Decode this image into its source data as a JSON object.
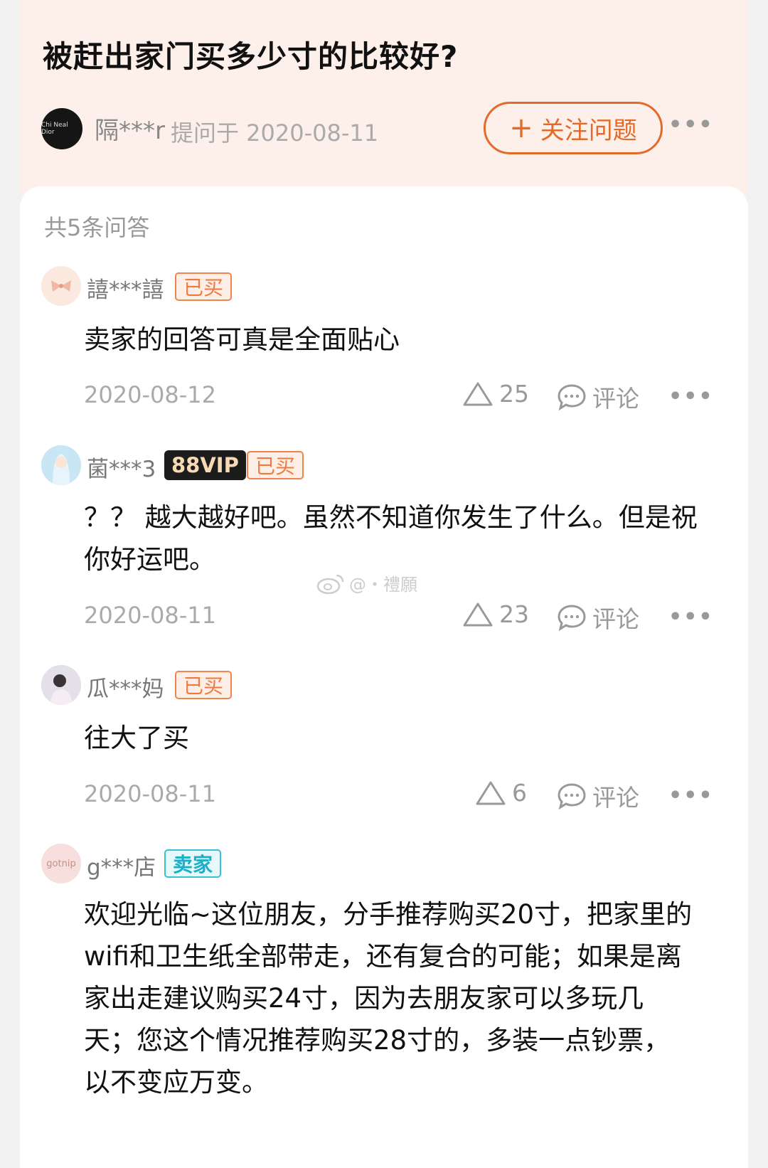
{
  "question": {
    "title": "被赶出家门买多少寸的比较好?",
    "asker_name": "隔***r",
    "asker_meta": "提问于 2020-08-11",
    "asker_avatar_text": "Chi Neal Dior",
    "follow_label": "关注问题",
    "follow_icon": "+"
  },
  "more_label": "•••",
  "count_label": "共5条问答",
  "answers": [
    {
      "user": "譆***譆",
      "badges": [
        "已买"
      ],
      "content": "卖家的回答可真是全面贴心",
      "date": "2020-08-12",
      "likes": "25",
      "comment_label": "评论"
    },
    {
      "user": "菌***3",
      "vip": "88VIP",
      "badges": [
        "已买"
      ],
      "content": "？？ 越大越好吧。虽然不知道你发生了什么。但是祝你好运吧。",
      "date": "2020-08-11",
      "likes": "23",
      "comment_label": "评论"
    },
    {
      "user": "瓜***妈",
      "badges": [
        "已买"
      ],
      "content": "往大了买",
      "date": "2020-08-11",
      "likes": "6",
      "comment_label": "评论"
    },
    {
      "user": "g***店",
      "avatar_text": "gotnip",
      "seller_badge": "卖家",
      "content": "欢迎光临~这位朋友，分手推荐购买20寸，把家里的wifi和卫生纸全部带走，还有复合的可能；如果是离家出走建议购买24寸，因为去朋友家可以多玩几天；您这个情况推荐购买28寸的，多装一点钞票，以不变应万变。"
    }
  ],
  "watermark": "@・禮願",
  "colors": {
    "accent": "#e36a28",
    "header_bg": "#fdf0ea",
    "seller": "#1ab0c8"
  }
}
